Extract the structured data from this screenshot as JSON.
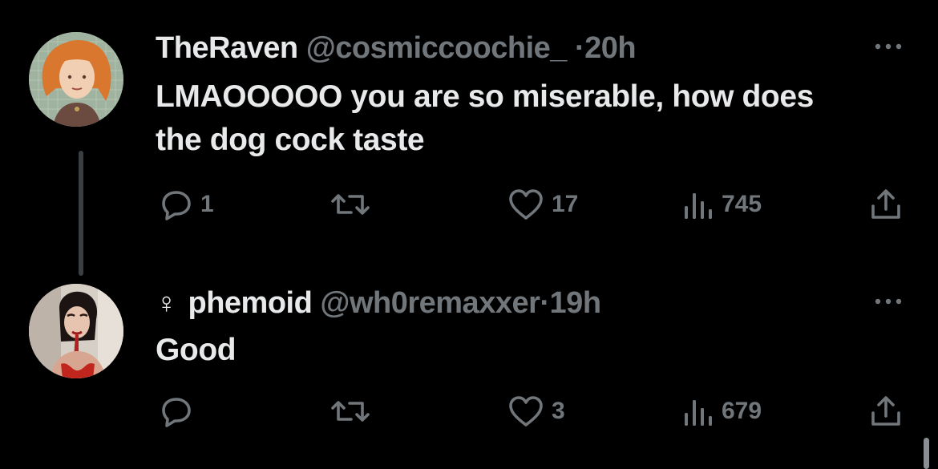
{
  "colors": {
    "background": "#000000",
    "primary_text": "#e7e9ea",
    "secondary_text": "#71767b",
    "thread_line": "#3a3f44"
  },
  "tweets": [
    {
      "display_name": "TheRaven",
      "handle": "@cosmiccoochie_",
      "separator": "·",
      "time": "20h",
      "text": "LMAOOOOO you are so miserable, how does the dog cock taste",
      "avatar_icon": "illustrated-avatar",
      "reply_count": "1",
      "retweet_count": "",
      "like_count": "17",
      "view_count": "745"
    },
    {
      "gender_symbol": "♀",
      "display_name": "phemoid",
      "handle": "@wh0remaxxer",
      "separator": "·",
      "time": "19h",
      "text": "Good",
      "avatar_icon": "photo-avatar",
      "reply_count": "",
      "retweet_count": "",
      "like_count": "3",
      "view_count": "679"
    }
  ],
  "icons": [
    "reply-icon",
    "retweet-icon",
    "like-icon",
    "views-icon",
    "share-icon",
    "more-icon"
  ]
}
